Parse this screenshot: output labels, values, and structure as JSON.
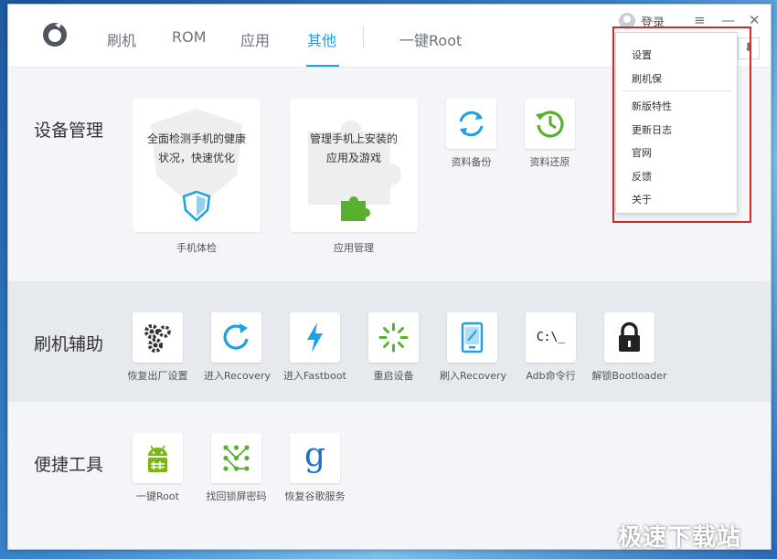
{
  "nav": {
    "items": [
      {
        "label": "刷机"
      },
      {
        "label": "ROM"
      },
      {
        "label": "应用"
      },
      {
        "label": "其他",
        "active": true
      },
      {
        "label": "一键Root"
      }
    ]
  },
  "user": {
    "login_label": "登录"
  },
  "window_controls": {
    "menu": "≡",
    "minimize": "—",
    "close": "✕"
  },
  "sections": {
    "device": {
      "title": "设备管理",
      "cards": [
        {
          "text_line1": "全面检测手机的健康",
          "text_line2": "状况，快速优化",
          "caption": "手机体检",
          "icon": "shield-icon"
        },
        {
          "text_line1": "管理手机上安装的",
          "text_line2": "应用及游戏",
          "caption": "应用管理",
          "icon": "puzzle-icon"
        }
      ],
      "tiles": [
        {
          "caption": "资料备份",
          "icon": "sync-icon"
        },
        {
          "caption": "资料还原",
          "icon": "restore-clock-icon"
        }
      ]
    },
    "flash": {
      "title": "刷机辅助",
      "tiles": [
        {
          "caption": "恢复出厂设置",
          "icon": "gears-icon"
        },
        {
          "caption": "进入Recovery",
          "icon": "refresh-icon"
        },
        {
          "caption": "进入Fastboot",
          "icon": "lightning-icon"
        },
        {
          "caption": "重启设备",
          "icon": "spinner-icon"
        },
        {
          "caption": "刷入Recovery",
          "icon": "tablet-icon"
        },
        {
          "caption": "Adb命令行",
          "icon": "terminal-icon",
          "glyph": "C:\\_"
        },
        {
          "caption": "解锁Bootloader",
          "icon": "lock-icon"
        }
      ]
    },
    "tools": {
      "title": "便捷工具",
      "tiles": [
        {
          "caption": "一键Root",
          "icon": "android-icon"
        },
        {
          "caption": "找回锁屏密码",
          "icon": "pattern-lock-icon"
        },
        {
          "caption": "恢复谷歌服务",
          "icon": "google-g-icon",
          "glyph": "g"
        }
      ]
    }
  },
  "dropdown_menu": {
    "items": [
      {
        "label": "设置"
      },
      {
        "label": "刷机保"
      },
      {
        "label": "新版特性"
      },
      {
        "label": "更新日志"
      },
      {
        "label": "官网"
      },
      {
        "label": "反馈"
      },
      {
        "label": "关于"
      }
    ]
  },
  "watermark": "极速下载站",
  "colors": {
    "accent": "#1da1e6",
    "highlight_border": "#d3282c",
    "green": "#58b02e"
  }
}
